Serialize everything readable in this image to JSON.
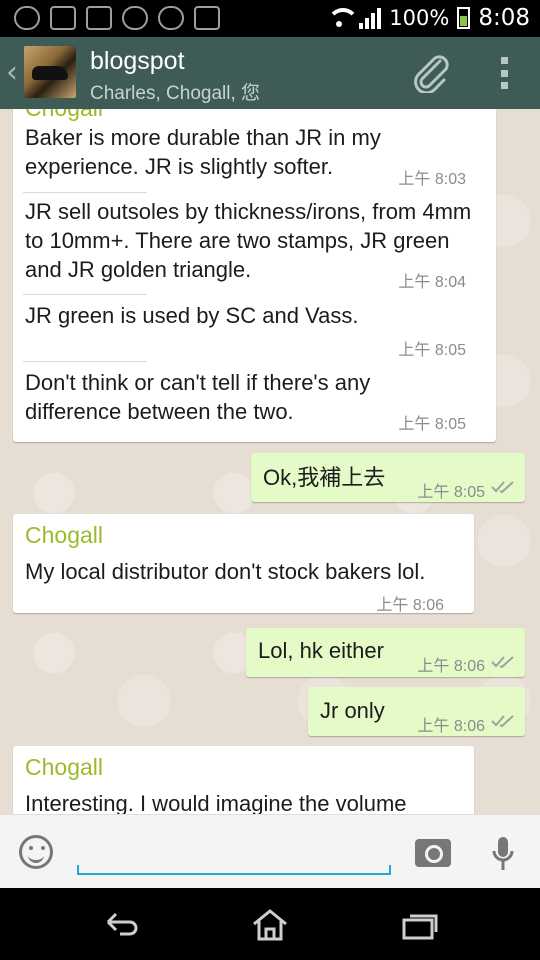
{
  "status_bar": {
    "battery_percent": "100%",
    "time": "8:08"
  },
  "header": {
    "title": "blogspot",
    "subtitle": "Charles, Chogall, 您"
  },
  "messages": [
    {
      "sender": "Chogall",
      "text": "Baker is more durable than JR in my experience. JR is slightly softer.",
      "time": "上午 8:03"
    },
    {
      "text": "JR sell outsoles by thickness/irons, from 4mm to 10mm+. There are two stamps, JR green and JR golden triangle.",
      "time": "上午 8:04"
    },
    {
      "text": "JR green is used by SC and Vass.",
      "time": "上午 8:05"
    },
    {
      "text": "Don't think or can't tell if there's any difference between the two.",
      "time": "上午 8:05"
    },
    {
      "text": "Ok,我補上去",
      "time": "上午 8:05"
    },
    {
      "sender": "Chogall",
      "text": "My local distributor don't stock bakers lol.",
      "time": "上午 8:06"
    },
    {
      "text": "Lol, hk either",
      "time": "上午 8:06"
    },
    {
      "text": "Jr only",
      "time": "上午 8:06"
    },
    {
      "sender": "Chogall",
      "text": "Interesting. I would imagine the volume",
      "time": ""
    }
  ],
  "input": {
    "placeholder": ""
  },
  "colors": {
    "header_bg": "#3f5b55",
    "sender_name": "#9cbb2c",
    "outgoing_bubble": "#e4fbc7",
    "input_underline": "#2aa8cf"
  }
}
